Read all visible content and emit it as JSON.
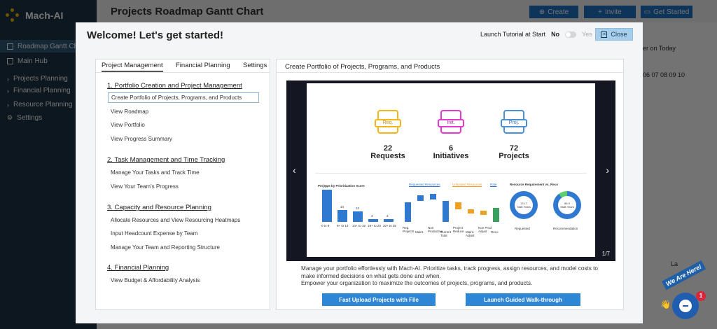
{
  "app": {
    "logo_text": "Mach-AI",
    "page_title": "Projects Roadmap Gantt Chart",
    "top_buttons": {
      "create": "Create",
      "invite": "Invite",
      "get_started": "Get Started"
    },
    "sidebar": [
      {
        "label": "Roadmap Gantt Chart",
        "icon": "grid-icon"
      },
      {
        "label": "Main Hub",
        "icon": "grid-icon"
      },
      {
        "label": "Projects Planning",
        "icon": "chevron-right-icon"
      },
      {
        "label": "Financial Planning",
        "icon": "chevron-right-icon"
      },
      {
        "label": "Resource Planning",
        "icon": "chevron-right-icon"
      },
      {
        "label": "Settings",
        "icon": "gear-icon"
      }
    ],
    "bg_snippets": {
      "on_today": "er on Today",
      "timeline": "06 07 08 09 10",
      "la": "La"
    }
  },
  "modal": {
    "title": "Welcome! Let's get started!",
    "tutorial_label": "Launch Tutorial at Start",
    "no": "No",
    "yes": "Yes",
    "close": "Close",
    "tabs": [
      "Project Management",
      "Financial Planning",
      "Settings"
    ],
    "sections": [
      {
        "heading": "1. Portfolio Creation and Project Management",
        "links": [
          "Create Portfolio of Projects, Programs, and Products",
          "View Roadmap",
          "View Portfolio",
          "View Progress Summary"
        ]
      },
      {
        "heading": "2. Task Management and Time Tracking",
        "links": [
          "Manage Your Tasks and Track Time",
          "View Your Team's Progress"
        ]
      },
      {
        "heading": "3. Capacity and Resource Planning",
        "links": [
          "Allocate Resources and View Resourcing Heatmaps",
          "Input Headcount Expense by Team",
          "Manage Your Team and Reporting Structure"
        ]
      },
      {
        "heading": "4. Financial Planning",
        "links": [
          "View Budget & Affordability Analysis"
        ]
      }
    ],
    "right_title": "Create Portfolio of Projects, Programs, and Products",
    "slide": {
      "pager": "1/7",
      "kpis": [
        {
          "tag": "Req.",
          "value": "22",
          "label": "Requests",
          "color": "#f2b51a"
        },
        {
          "tag": "Init.",
          "value": "6",
          "label": "Initiatives",
          "color": "#e23ad1"
        },
        {
          "tag": "Proj.",
          "value": "72",
          "label": "Projects",
          "color": "#4a8fd8"
        }
      ],
      "chart1": {
        "title": "Projects by Prioritization Score",
        "categories": [
          "0 to 9",
          "9+ to 14",
          "14+ to 19",
          "19+ to 20",
          "20+ to 25"
        ],
        "values": [
          37,
          14,
          12,
          3,
          3
        ]
      },
      "chart2": {
        "legend": [
          "Requested Resources",
          "Unfunded Resources",
          "Rate"
        ],
        "categories": [
          "Req. Projects",
          "Maint.",
          "Non Productive",
          "Current Total",
          "Project Reduce",
          "Maint. Adjust",
          "Non Prod Adjust",
          "Reco"
        ]
      },
      "chart3": {
        "title": "Resource Requirement vs. Reco",
        "donuts": [
          {
            "value": "174.7",
            "unit": "Staff-Years",
            "label": "Requested"
          },
          {
            "value": "86.9",
            "unit": "Staff-Years",
            "label": "Recommendation"
          }
        ]
      }
    },
    "description": [
      "Manage your portfolio effortlessly with Mach-AI. Prioritize tasks, track progress, assign resources, and model costs to make informed decisions on what gets done and when.",
      "Empower your organization to maximize the outcomes of projects, programs, and products."
    ],
    "buttons": {
      "upload": "Fast Upload Projects with File",
      "walkthrough": "Launch Guided Walk-through"
    }
  },
  "chat": {
    "banner": "We Are Here!",
    "badge": "1"
  }
}
